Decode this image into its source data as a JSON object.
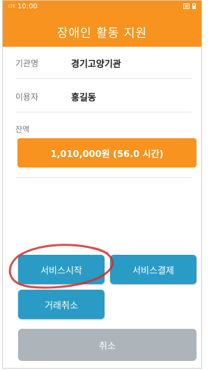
{
  "status_bar": {
    "network": "LTE",
    "time": "10:00",
    "sim_icon": "sim-card-icon",
    "battery_icon": "battery-icon"
  },
  "app_bar": {
    "title": "장애인 활동 지원"
  },
  "info": {
    "agency": {
      "label": "기관명",
      "value": "경기고양기관"
    },
    "user": {
      "label": "이용자",
      "value": "홍길동"
    }
  },
  "balance": {
    "label": "잔액",
    "display": "1,010,000원 (56.0 시간)"
  },
  "buttons": {
    "service_start": "서비스시작",
    "service_payment": "서비스결제",
    "transaction_cancel": "거래취소",
    "cancel": "취소"
  },
  "colors": {
    "accent": "#f7931e",
    "button": "#2a9bc4",
    "button_disabled": "#adb5ba",
    "annotation": "#d62b2b"
  }
}
